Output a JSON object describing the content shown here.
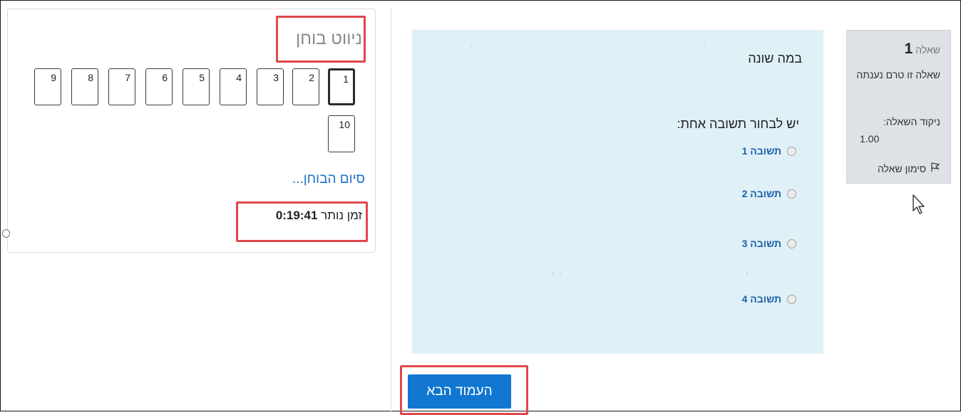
{
  "nav": {
    "title": "ניווט בוחן",
    "questions": [
      "1",
      "2",
      "3",
      "4",
      "5",
      "6",
      "7",
      "8",
      "9",
      "10"
    ],
    "current": "1",
    "finish_link": "סיום הבוחן...",
    "timer_label": "זמן נותר",
    "timer_value": "0:19:41"
  },
  "question": {
    "info": {
      "label": "שאלה",
      "number": "1",
      "state": "שאלה זו טרם נענתה",
      "grade_label": "ניקוד השאלה:",
      "grade_value": "1.00",
      "flag_label": "סימון שאלה",
      "flag_icon": "flag-icon"
    },
    "text": "במה שונה",
    "prompt": "יש לבחור תשובה אחת:",
    "answers": [
      "תשובה 1",
      "תשובה 2",
      "תשובה 3",
      "תשובה 4"
    ]
  },
  "footer": {
    "next_button": "העמוד הבא"
  },
  "colors": {
    "highlight": "#e0474c",
    "primary": "#1177d1",
    "content_bg": "#dff0f7",
    "info_bg": "#dee2e6",
    "link": "#1a73c8"
  }
}
